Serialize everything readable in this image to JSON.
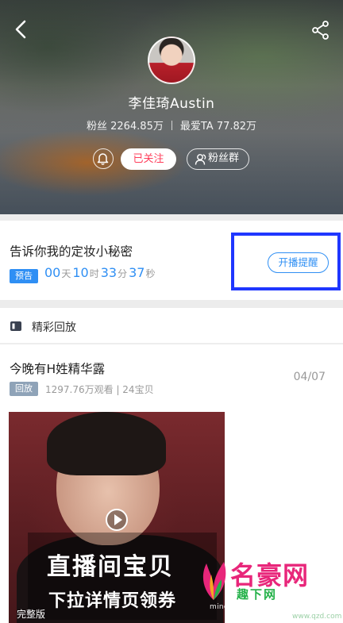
{
  "header": {
    "name": "李佳琦Austin",
    "fans_text": "粉丝 2264.85万",
    "love_text": "最爱TA 77.82万",
    "follow_label": "已关注",
    "fans_group_label": "粉丝群"
  },
  "live_preview": {
    "title": "告诉你我的定妆小秘密",
    "badge": "预告",
    "countdown": {
      "days": "00",
      "day_unit": "天",
      "hours": "10",
      "hour_unit": "时",
      "minutes": "33",
      "minute_unit": "分",
      "seconds": "37",
      "second_unit": "秒"
    },
    "remind_label": "开播提醒"
  },
  "replay": {
    "section_title": "精彩回放",
    "item": {
      "title": "今晚有H姓精华露",
      "date": "04/07",
      "badge": "回放",
      "meta": "1297.76万观看 | 24宝贝",
      "overlay_line1": "直播间宝贝",
      "overlay_line2": "下拉详情页领券",
      "full_label": "完整版"
    }
  },
  "watermark": {
    "brand": "名豪网",
    "sub": "趣下网",
    "pinyin": "minghaoshangwu.com",
    "url": "www.qzd.com"
  },
  "colors": {
    "accent_blue": "#2f8ff4",
    "follow_red": "#ff3d5a",
    "highlight_box": "#1f37ff"
  },
  "icons": [
    "back-arrow-icon",
    "share-icon",
    "bell-icon",
    "fans-group-icon",
    "replay-video-icon",
    "play-icon"
  ]
}
